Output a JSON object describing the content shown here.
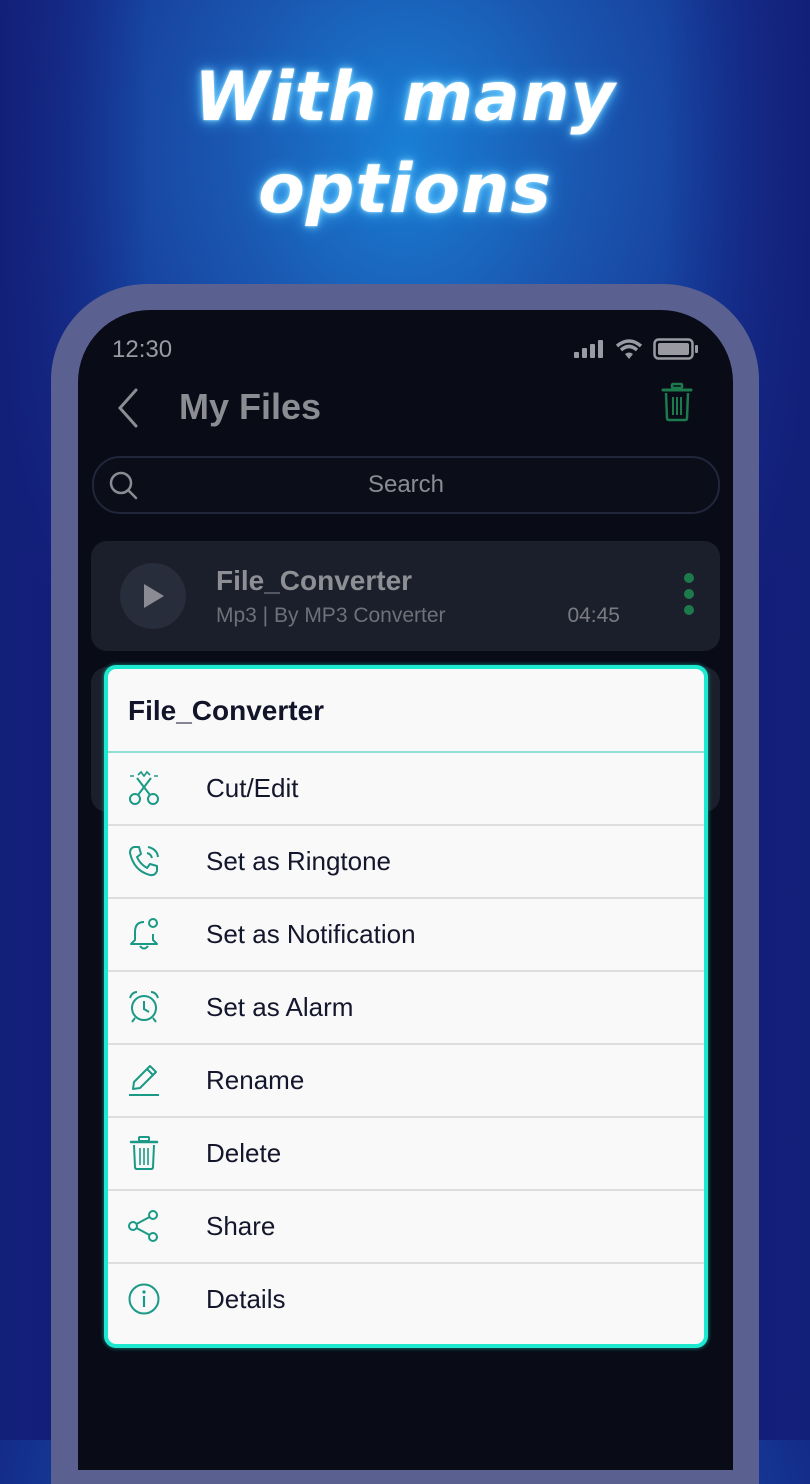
{
  "headline": {
    "line1": "With many",
    "line2": "options"
  },
  "status_bar": {
    "time": "12:30"
  },
  "header": {
    "title": "My Files",
    "back_icon": "chevron-left-icon",
    "trash_icon": "trash-icon"
  },
  "search": {
    "placeholder": "Search"
  },
  "files": [
    {
      "name": "File_Converter",
      "meta": "Mp3 | By MP3 Converter",
      "duration": "04:45"
    }
  ],
  "dialog": {
    "title": "File_Converter",
    "items": [
      {
        "label": "Cut/Edit",
        "icon": "scissors-icon"
      },
      {
        "label": "Set as Ringtone",
        "icon": "phone-ring-icon"
      },
      {
        "label": "Set as Notification",
        "icon": "bell-icon"
      },
      {
        "label": "Set as Alarm",
        "icon": "alarm-clock-icon"
      },
      {
        "label": "Rename",
        "icon": "pencil-icon"
      },
      {
        "label": "Delete",
        "icon": "trash-icon"
      },
      {
        "label": "Share",
        "icon": "share-icon"
      },
      {
        "label": "Details",
        "icon": "info-icon"
      }
    ]
  },
  "colors": {
    "accent_teal": "#1de8d0",
    "icon_teal": "#1a9a86",
    "trash_green": "#1d7a4c",
    "screen_bg": "#090b17"
  }
}
